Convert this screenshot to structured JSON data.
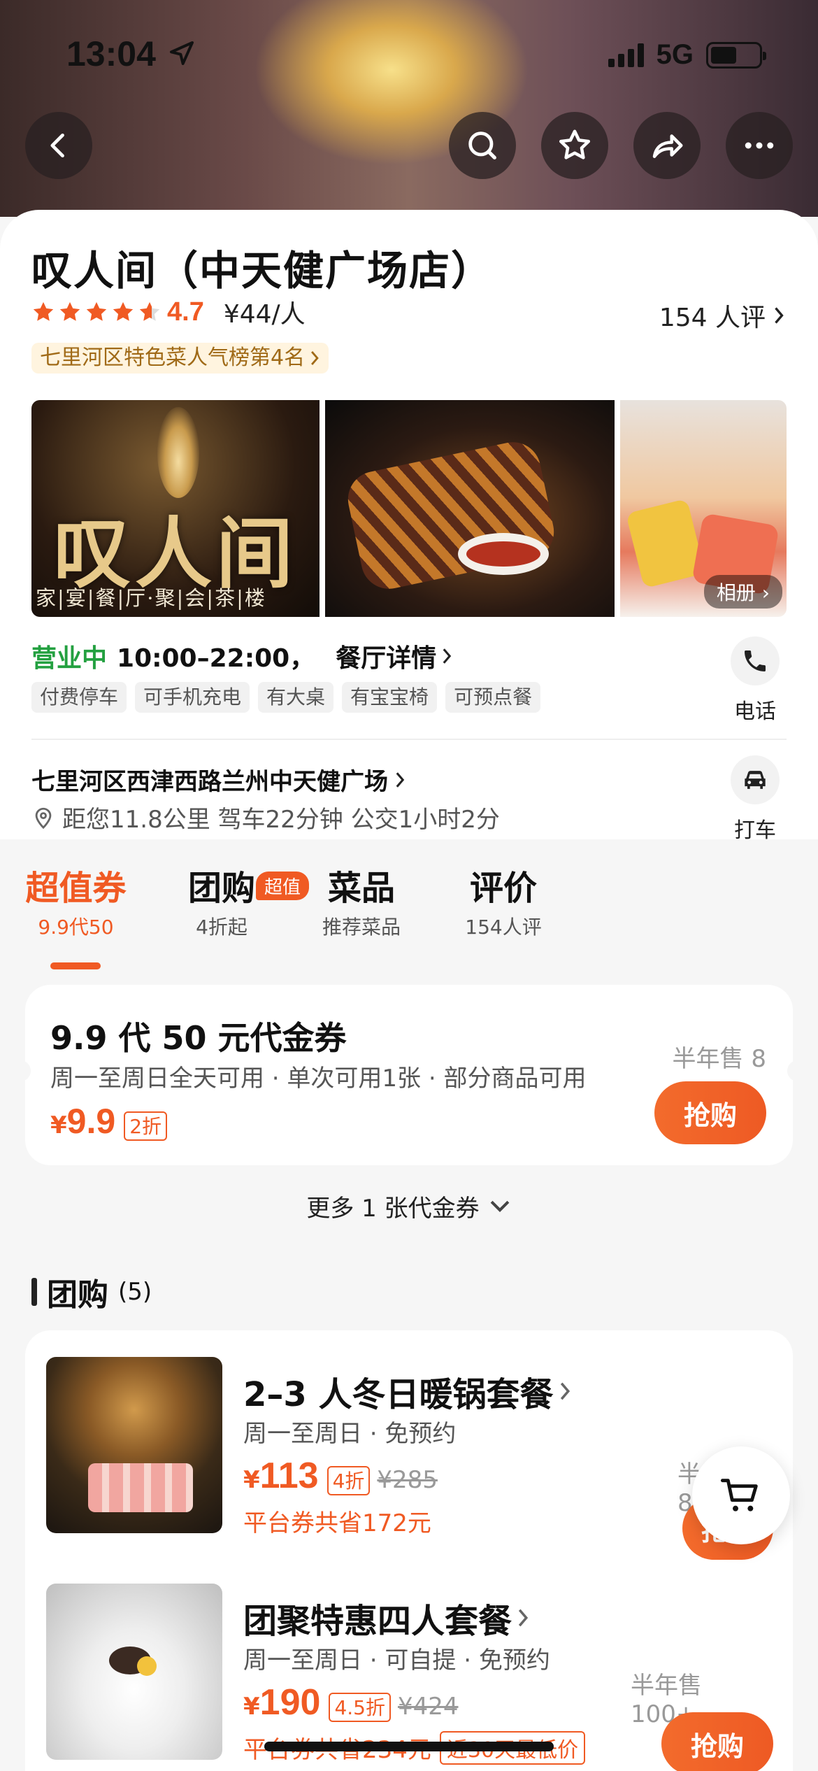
{
  "status": {
    "time": "13:04",
    "network": "5G"
  },
  "shop": {
    "name": "叹人间（中天健广场店）",
    "rating": "4.7",
    "price_per": "¥44/人",
    "reviews": "154 人评",
    "rank_badge": "七里河区特色菜人气榜第4名",
    "logo_text": "叹人间",
    "logo_sub": "家|宴|餐|厅·聚|会|茶|楼",
    "album": "相册"
  },
  "hours": {
    "open_label": "营业中",
    "time": "10:00–22:00，",
    "detail": "餐厅详情"
  },
  "tags": [
    "付费停车",
    "可手机充电",
    "有大桌",
    "有宝宝椅",
    "可预点餐"
  ],
  "actions": {
    "phone": "电话",
    "taxi": "打车"
  },
  "location": {
    "address": "七里河区西津西路兰州中天健广场",
    "distance": "距您11.8公里 驾车22分钟 公交1小时2分"
  },
  "tabs": [
    {
      "title": "超值券",
      "sub": "9.9代50"
    },
    {
      "title": "团购",
      "sub": "4折起"
    },
    {
      "title": "菜品",
      "sub": "推荐菜品"
    },
    {
      "title": "评价",
      "sub": "154人评"
    }
  ],
  "tab_badge": "超值",
  "voucher": {
    "title": "9.9 代 50 元代金券",
    "desc": "周一至周日全天可用 · 单次可用1张 · 部分商品可用",
    "yen": "¥",
    "price": "9.9",
    "discount": "2折",
    "sold": "半年售 8",
    "buy": "抢购"
  },
  "more_vouchers": "更多 1 张代金券",
  "group": {
    "title": "团购",
    "count": "(5)"
  },
  "deals": [
    {
      "title": "2–3 人冬日暖锅套餐",
      "sub": "周一至周日 · 免预约",
      "yen": "¥",
      "price": "113",
      "discount": "4折",
      "orig": "¥285",
      "save": "平台券共省172元",
      "sold": "半年售 88",
      "buy": "抢购"
    },
    {
      "title": "团聚特惠四人套餐",
      "sub": "周一至周日 · 可自提 · 免预约",
      "yen": "¥",
      "price": "190",
      "discount": "4.5折",
      "orig": "¥424",
      "save": "平台券共省234元",
      "badge": "近30天最低价",
      "sold": "半年售 100+",
      "buy": "抢购"
    }
  ],
  "colors": {
    "accent": "#f05a23",
    "open_green": "#23a040"
  }
}
